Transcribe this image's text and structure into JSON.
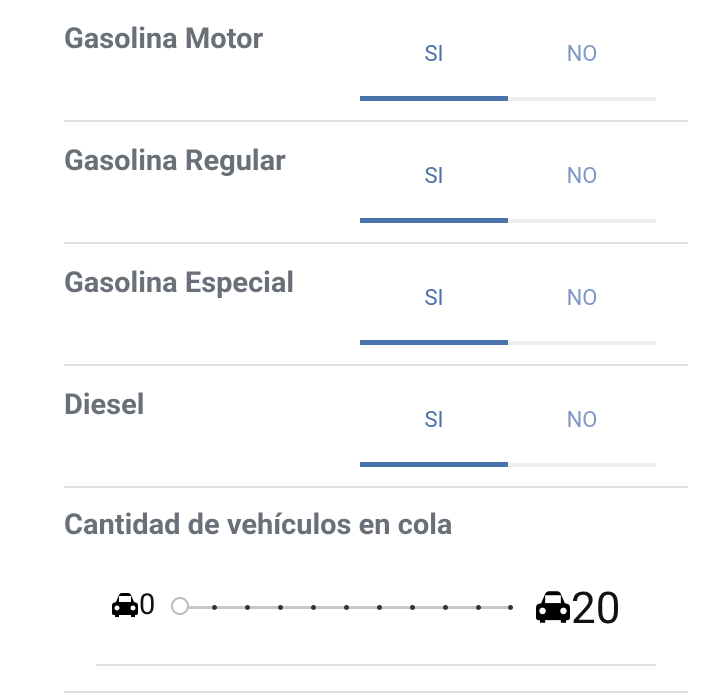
{
  "fuels": [
    {
      "label": "Gasolina Motor",
      "yes": "SI",
      "no": "NO",
      "selected": "SI"
    },
    {
      "label": "Gasolina Regular",
      "yes": "SI",
      "no": "NO",
      "selected": "SI"
    },
    {
      "label": "Gasolina Especial",
      "yes": "SI",
      "no": "NO",
      "selected": "SI"
    },
    {
      "label": "Diesel",
      "yes": "SI",
      "no": "NO",
      "selected": "SI"
    }
  ],
  "queue": {
    "title": "Cantidad de vehículos en cola",
    "min_label": "0",
    "max_label": "20",
    "value": 0,
    "min": 0,
    "max": 20,
    "min_icon": "car-icon",
    "max_icon": "car-icon"
  },
  "colors": {
    "accent": "#4a72ab",
    "label_text": "#6a7077",
    "tab_no_text": "#7c98c3"
  }
}
